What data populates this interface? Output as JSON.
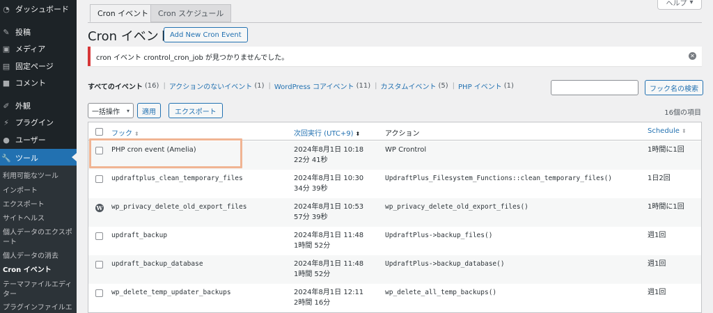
{
  "sidebar": {
    "items": [
      {
        "label": "ダッシュボード",
        "icon": "dashboard-icon"
      },
      {
        "label": "投稿",
        "icon": "pin-icon"
      },
      {
        "label": "メディア",
        "icon": "media-icon"
      },
      {
        "label": "固定ページ",
        "icon": "page-icon"
      },
      {
        "label": "コメント",
        "icon": "comment-icon"
      },
      {
        "label": "外観",
        "icon": "brush-icon"
      },
      {
        "label": "プラグイン",
        "icon": "plugin-icon"
      },
      {
        "label": "ユーザー",
        "icon": "user-icon"
      },
      {
        "label": "ツール",
        "icon": "wrench-icon"
      }
    ],
    "submenu": [
      "利用可能なツール",
      "インポート",
      "エクスポート",
      "サイトヘルス",
      "個人データのエクスポート",
      "個人データの消去",
      "Cron イベント",
      "テーマファイルエディター",
      "プラグインファイルエ"
    ]
  },
  "tabs": [
    {
      "label": "Cron イベント"
    },
    {
      "label": "Cron スケジュール"
    }
  ],
  "help": {
    "label": "ヘルプ",
    "chevron": "▾"
  },
  "page": {
    "title": "Cron イベント",
    "add_new_label": "Add New Cron Event"
  },
  "notice": {
    "text": "cron イベント crontrol_cron_job が見つかりませんでした。",
    "close_glyph": "✕"
  },
  "filters": [
    {
      "label": "すべてのイベント",
      "count": "(16)"
    },
    {
      "label": "アクションのないイベント",
      "count": "(1)"
    },
    {
      "label": "WordPress コアイベント",
      "count": "(11)"
    },
    {
      "label": "カスタムイベント",
      "count": "(5)"
    },
    {
      "label": "PHP イベント",
      "count": "(1)"
    }
  ],
  "filter_separator": "|",
  "search": {
    "placeholder": "",
    "button_label": "フック名の検索"
  },
  "bulk": {
    "label": "一括操作",
    "chevron": "▾",
    "apply_label": "適用",
    "export_label": "エクスポート"
  },
  "items_count": "16個の項目",
  "table": {
    "headers": {
      "hook": "フック",
      "next_run": "次回実行 (UTC+9)",
      "action": "アクション",
      "schedule": "Schedule"
    },
    "sort_glyph": "⬍",
    "rows": [
      {
        "hook": "PHP cron event (Amelia)",
        "next_run": "2024年8月1日 10:18",
        "next_run_rel": "22分 41秒",
        "action": "WP Crontrol",
        "schedule": "1時間に1回",
        "marker": "checkbox",
        "action_mono": false
      },
      {
        "hook": "updraftplus_clean_temporary_files",
        "next_run": "2024年8月1日 10:30",
        "next_run_rel": "34分 39秒",
        "action": "UpdraftPlus_Filesystem_Functions::clean_temporary_files()",
        "schedule": "1日2回",
        "marker": "checkbox",
        "action_mono": true
      },
      {
        "hook": "wp_privacy_delete_old_export_files",
        "next_run": "2024年8月1日 10:53",
        "next_run_rel": "57分 39秒",
        "action": "wp_privacy_delete_old_export_files()",
        "schedule": "1時間に1回",
        "marker": "wordpress-icon",
        "action_mono": true
      },
      {
        "hook": "updraft_backup",
        "next_run": "2024年8月1日 11:48",
        "next_run_rel": "1時間 52分",
        "action": "UpdraftPlus->backup_files()",
        "schedule": "週1回",
        "marker": "checkbox",
        "action_mono": true
      },
      {
        "hook": "updraft_backup_database",
        "next_run": "2024年8月1日 11:48",
        "next_run_rel": "1時間 52分",
        "action": "UpdraftPlus->backup_database()",
        "schedule": "週1回",
        "marker": "checkbox",
        "action_mono": true
      },
      {
        "hook": "wp_delete_temp_updater_backups",
        "next_run": "2024年8月1日 12:11",
        "next_run_rel": "2時間 16分",
        "action": "wp_delete_all_temp_backups()",
        "schedule": "週1回",
        "marker": "checkbox",
        "action_mono": true
      }
    ]
  },
  "colors": {
    "accent": "#2271b1",
    "sidebar_bg": "#1d2327",
    "notice_error": "#d63638",
    "highlight": "#f0b493"
  }
}
